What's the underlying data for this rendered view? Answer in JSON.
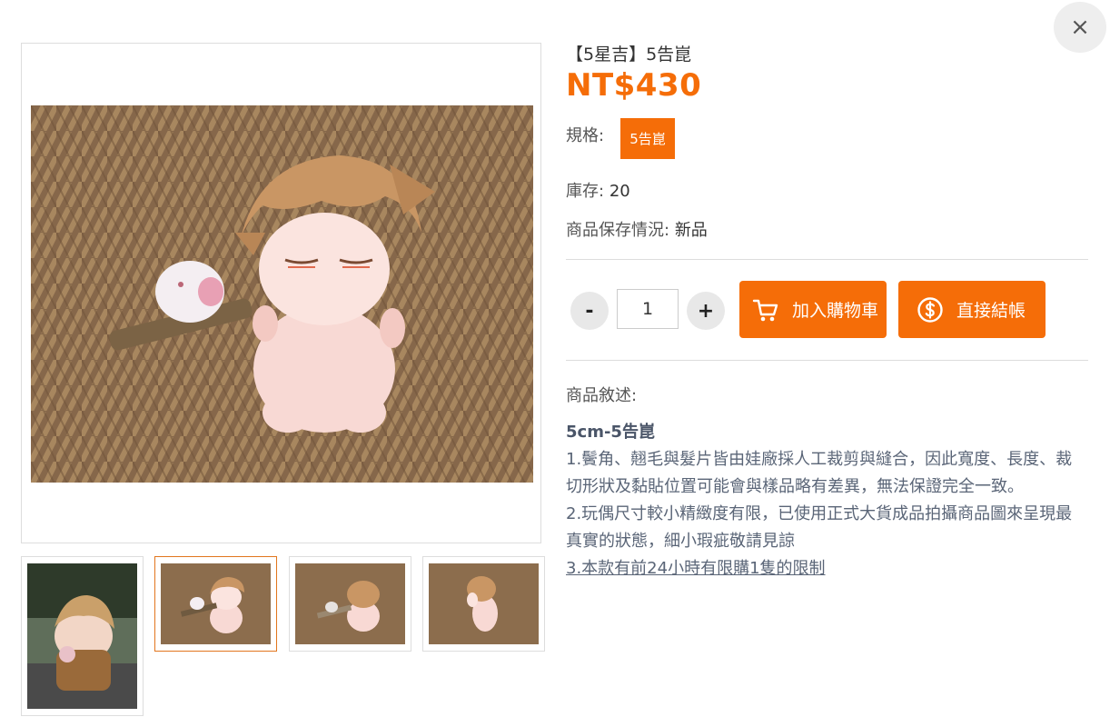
{
  "close_label": "×",
  "product": {
    "title": "【5星吉】5告崑",
    "price": "NT$430",
    "spec_label": "規格:",
    "spec_option": "5告崑",
    "stock_label": "庫存:",
    "stock_value": "20",
    "condition_label": "商品保存情況:",
    "condition_value": "新品"
  },
  "quantity": {
    "minus": "-",
    "value": "1",
    "plus": "+"
  },
  "actions": {
    "add_to_cart": "加入購物車",
    "checkout": "直接結帳"
  },
  "description": {
    "label": "商品敘述:",
    "heading": "5cm-5告崑",
    "line1": "1.鬢角、翹毛與髮片皆由娃廠採人工裁剪與縫合，因此寬度、長度、裁切形狀及黏貼位置可能會與樣品略有差異，無法保證完全一致。",
    "line2": "2.玩偶尺寸較小精緻度有限，已使用正式大貨成品拍攝商品圖來呈現最真實的狀態，細小瑕疵敬請見諒",
    "line3": "3.本款有前24小時有限購1隻的限制"
  },
  "colors": {
    "accent": "#f56d08",
    "burlap": "#8a6a4a",
    "plush": "#f6d7d2",
    "hair": "#c99664"
  },
  "icons": {
    "close": "close-icon",
    "cart": "cart-icon",
    "checkout": "dollar-coin-icon"
  }
}
